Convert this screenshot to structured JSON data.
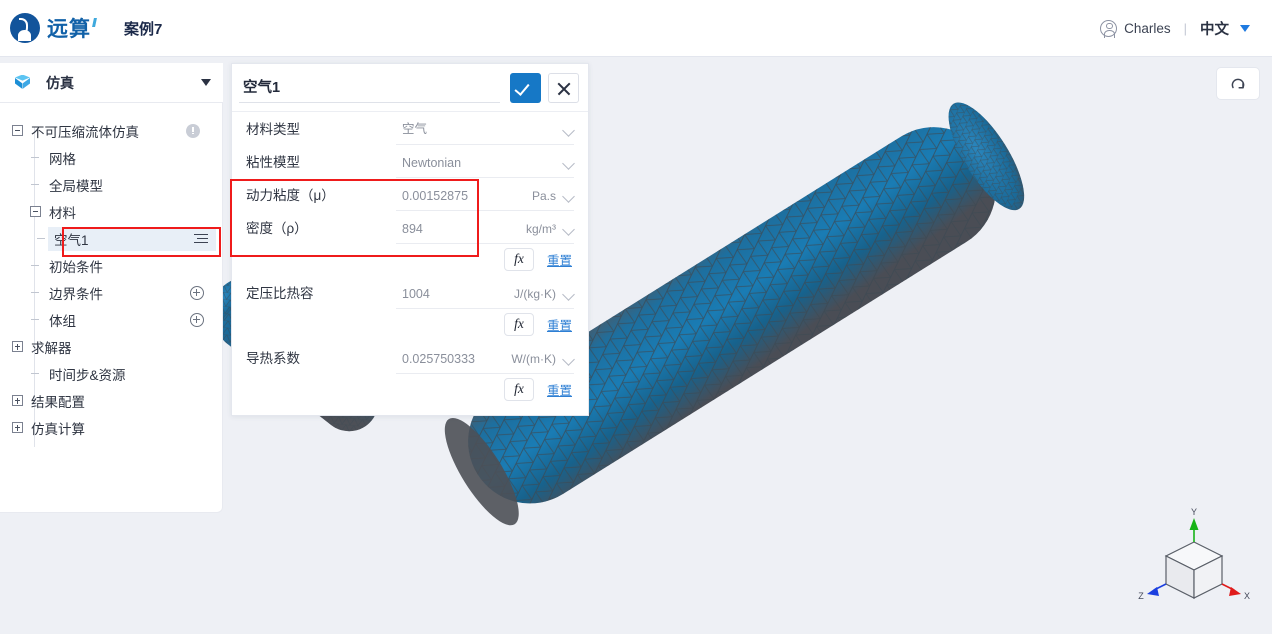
{
  "header": {
    "logo_text": "远算",
    "logo_icon": "brand-circle-logo",
    "case_title": "案例7",
    "user_icon": "user-avatar-icon",
    "user_name": "Charles",
    "separator": "|",
    "language": "中文",
    "lang_caret_icon": "caret-down-icon",
    "accent_blue": "#1f7ae0"
  },
  "sidebar": {
    "module_icon": "cube-icon",
    "module_label": "仿真",
    "module_caret_icon": "caret-down-icon",
    "tree": [
      {
        "label": "不可压缩流体仿真",
        "level": 1,
        "toggle": "minus",
        "badge": "warning-icon"
      },
      {
        "label": "网格",
        "level": 2,
        "toggle": "dash",
        "badge": ""
      },
      {
        "label": "全局模型",
        "level": 2,
        "toggle": "dash",
        "badge": ""
      },
      {
        "label": "材料",
        "level": 2,
        "toggle": "minus",
        "badge": ""
      },
      {
        "label": "空气1",
        "level": 3,
        "toggle": "dash",
        "badge": "list-icon",
        "selected": true
      },
      {
        "label": "初始条件",
        "level": 2,
        "toggle": "dash",
        "badge": ""
      },
      {
        "label": "边界条件",
        "level": 2,
        "toggle": "dash",
        "badge": "plus-circle-icon"
      },
      {
        "label": "体组",
        "level": 2,
        "toggle": "dash",
        "badge": "plus-circle-icon"
      },
      {
        "label": "求解器",
        "level": 2,
        "toggle": "plus",
        "badge": ""
      },
      {
        "label": "时间步&资源",
        "level": 2,
        "toggle": "dash",
        "badge": ""
      },
      {
        "label": "结果配置",
        "level": 2,
        "toggle": "plus",
        "badge": ""
      },
      {
        "label": "仿真计算",
        "level": 2,
        "toggle": "plus",
        "badge": ""
      }
    ]
  },
  "panel": {
    "name_value": "空气1",
    "name_placeholder": "",
    "confirm_icon": "check-icon",
    "cancel_icon": "close-icon",
    "rows": [
      {
        "label": "材料类型",
        "value": "空气",
        "unit": "",
        "has_fx": false
      },
      {
        "label": "粘性模型",
        "value": "Newtonian",
        "unit": "",
        "has_fx": false
      },
      {
        "label": "动力粘度（μ）",
        "value": "0.00152875",
        "unit": "Pa.s",
        "has_fx": false
      },
      {
        "label": "密度（ρ）",
        "value": "894",
        "unit": "kg/m³",
        "has_fx": true
      },
      {
        "label": "定压比热容",
        "value": "1004",
        "unit": "J/(kg·K)",
        "has_fx": true
      },
      {
        "label": "导热系数",
        "value": "0.025750333",
        "unit": "W/(m·K)",
        "has_fx": true
      }
    ],
    "fx_label": "fx",
    "reset_label": "重置"
  },
  "viewport": {
    "refresh_icon": "refresh-arc-icon",
    "model_name": "pipe-mesh-model",
    "mesh_color": "#1a6fa0",
    "background_color": "#eef0f5",
    "axes": {
      "x_label": "X",
      "x_color": "#e01b1b",
      "y_label": "Y",
      "y_color": "#17b317",
      "z_label": "Z",
      "z_color": "#1b3fe0"
    }
  },
  "annotations": {
    "highlight_color": "#ef1b1b",
    "boxes": [
      "tree-selected-material",
      "viscosity-and-density-fields"
    ]
  }
}
